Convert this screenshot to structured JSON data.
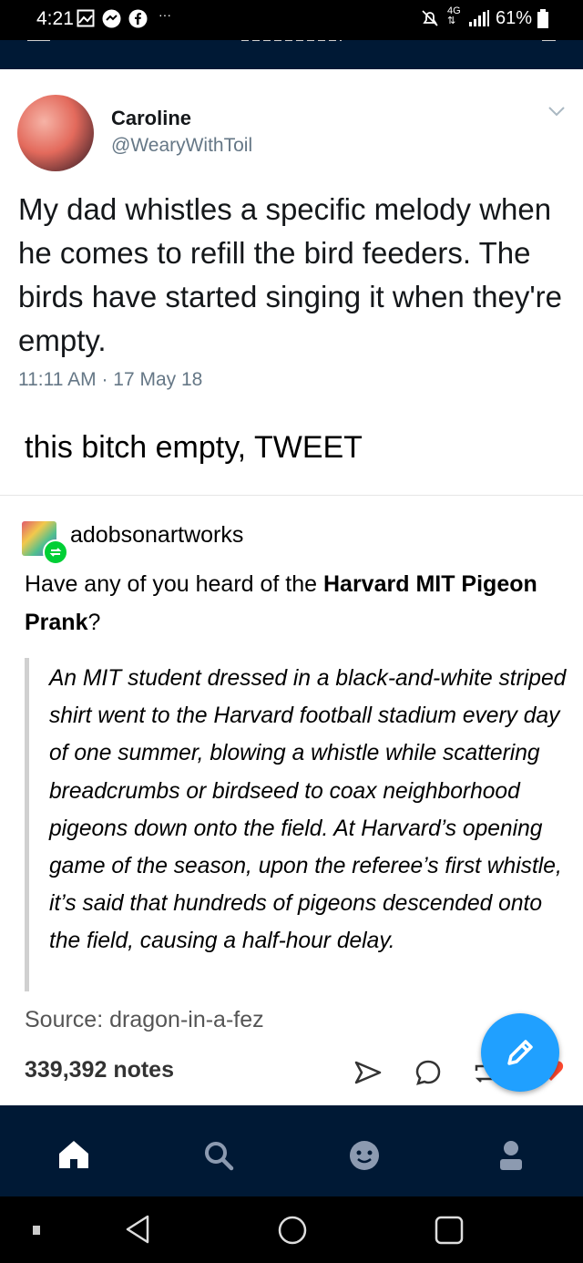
{
  "status_bar": {
    "time": "4:21",
    "battery": "61%",
    "left_icons": [
      "image-icon",
      "messenger-icon",
      "facebook-icon",
      "more-icon"
    ],
    "right_icons": [
      "mute-icon",
      "4g-icon",
      "signal-icon",
      "battery-icon"
    ]
  },
  "tweet": {
    "name": "Caroline",
    "handle": "@WearyWithToil",
    "text": "My dad whistles a specific melody when he comes to refill the bird feeders. The birds have started singing it when they're empty.",
    "timestamp": "11:11 AM · 17 May 18"
  },
  "caption": "this bitch empty, TWEET",
  "post": {
    "username": "adobsonartworks",
    "question_prefix": "Have any of you heard of the ",
    "question_bold": "Harvard MIT Pigeon Prank",
    "question_suffix": "?",
    "quote": "An MIT student dressed in a  black-and-white striped shirt went to the Harvard football stadium every  day of one summer, blowing a whistle while scattering breadcrumbs or birdseed to coax neighborhood pigeons down onto the field. At  Harvard’s opening game of the season, upon the referee’s first whistle, it’s said that hundreds of pigeons descended onto the field, causing a  half-hour delay.",
    "source": "Source: dragon-in-a-fez",
    "notes": "339,392 notes"
  },
  "colors": {
    "navy": "#001935",
    "fab_blue": "#20a0ff",
    "reblog_green": "#00cf35",
    "muted_gray": "#657786"
  }
}
